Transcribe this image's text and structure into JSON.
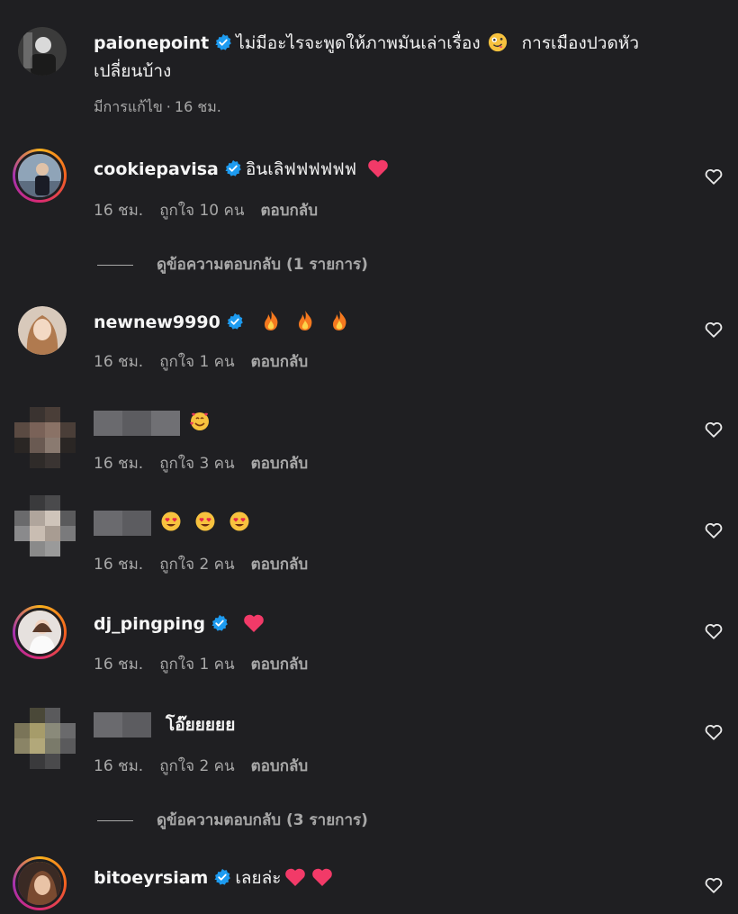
{
  "caption": {
    "username": "paionepoint",
    "text_line1": "ไม่มีอะไรจะพูดให้ภาพมันเล่าเรื่อง",
    "text_line1b": "การเมืองปวดหัว",
    "text_line2": "เปลี่ยนบ้าง",
    "edited": "มีการแก้ไข",
    "time": "16 ชม."
  },
  "comments": [
    {
      "username": "cookiepavisa",
      "text": "อินเลิฟฟฟฟฟฟ",
      "time": "16 ชม.",
      "likes": "ถูกใจ 10 คน",
      "reply": "ตอบกลับ",
      "view_replies": "ดูข้อความตอบกลับ (1 รายการ)"
    },
    {
      "username": "newnew9990",
      "text": "",
      "time": "16 ชม.",
      "likes": "ถูกใจ 1 คน",
      "reply": "ตอบกลับ"
    },
    {
      "username": "",
      "text": "",
      "time": "16 ชม.",
      "likes": "ถูกใจ 3 คน",
      "reply": "ตอบกลับ"
    },
    {
      "username": "",
      "text": "",
      "time": "16 ชม.",
      "likes": "ถูกใจ 2 คน",
      "reply": "ตอบกลับ"
    },
    {
      "username": "dj_pingping",
      "text": "",
      "time": "16 ชม.",
      "likes": "ถูกใจ 1 คน",
      "reply": "ตอบกลับ"
    },
    {
      "username": "",
      "text": "โอ๊ยยยยย",
      "time": "16 ชม.",
      "likes": "ถูกใจ 2 คน",
      "reply": "ตอบกลับ",
      "view_replies": "ดูข้อความตอบกลับ (3 รายการ)"
    },
    {
      "username": "bitoeyrsiam",
      "text": "เลยล่ะ",
      "time": "",
      "likes": "",
      "reply": ""
    }
  ],
  "icons": {
    "verified": "verified-badge-icon",
    "like": "heart-outline-icon",
    "red_heart": "red-heart-emoji",
    "fire": "fire-emoji",
    "heart_eyes": "heart-eyes-emoji",
    "smiling_hearts": "smiling-face-with-hearts-emoji",
    "zany": "zany-face-emoji"
  },
  "colors": {
    "background": "#1f1f22",
    "verified": "#1d9bf0",
    "meta_text": "#a8a8a8"
  }
}
